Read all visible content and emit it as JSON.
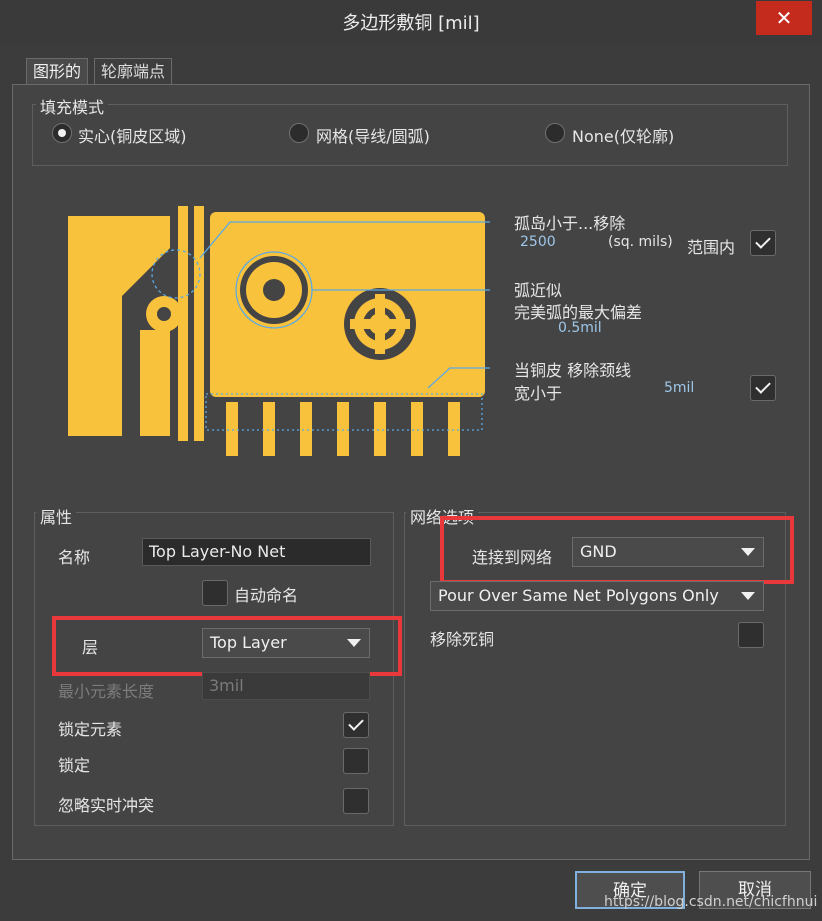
{
  "dialog": {
    "title": "多边形敷铜 [mil]",
    "close_label": "✕"
  },
  "tabs": [
    "图形的",
    "轮廓端点"
  ],
  "fill_mode": {
    "legend": "填充模式",
    "options": [
      "实心(铜皮区域)",
      "网格(导线/圆弧)",
      "None(仅轮廓)"
    ],
    "selected": "实心(铜皮区域)"
  },
  "diagram_labels": {
    "island_label": "孤岛小于...移除",
    "island_value": "2500",
    "island_unit": "(sq. mils)",
    "island_within": "范围内",
    "island_checked": true,
    "arc_label": "弧近似",
    "arc_desc": "完美弧的最大偏差",
    "arc_value": "0.5mil",
    "neck_label1": "当铜皮  移除颈线",
    "neck_label2": "宽小于",
    "neck_value": "5mil",
    "neck_checked": true
  },
  "properties": {
    "legend": "属性",
    "name_label": "名称",
    "name_value": "Top Layer-No Net",
    "auto_name_label": "自动命名",
    "auto_name_checked": false,
    "layer_label": "层",
    "layer_value": "Top Layer",
    "min_len_label": "最小元素长度",
    "min_len_value": "3mil",
    "lock_primitives_label": "锁定元素",
    "lock_primitives_checked": true,
    "locked_label": "锁定",
    "locked_checked": false,
    "ignore_violations_label": "忽略实时冲突",
    "ignore_violations_checked": false
  },
  "net_options": {
    "legend": "网络选项",
    "connect_label": "连接到网络",
    "connect_value": "GND",
    "pour_mode": "Pour Over Same Net Polygons Only",
    "remove_dead_label": "移除死铜",
    "remove_dead_checked": false
  },
  "footer": {
    "ok_label": "确定",
    "cancel_label": "取消",
    "watermark": "https://blog.csdn.net/chicfhnui"
  },
  "colors": {
    "copper": "#f9c23c",
    "annotation": "#5aa9e6",
    "highlight": "#e8383b"
  }
}
